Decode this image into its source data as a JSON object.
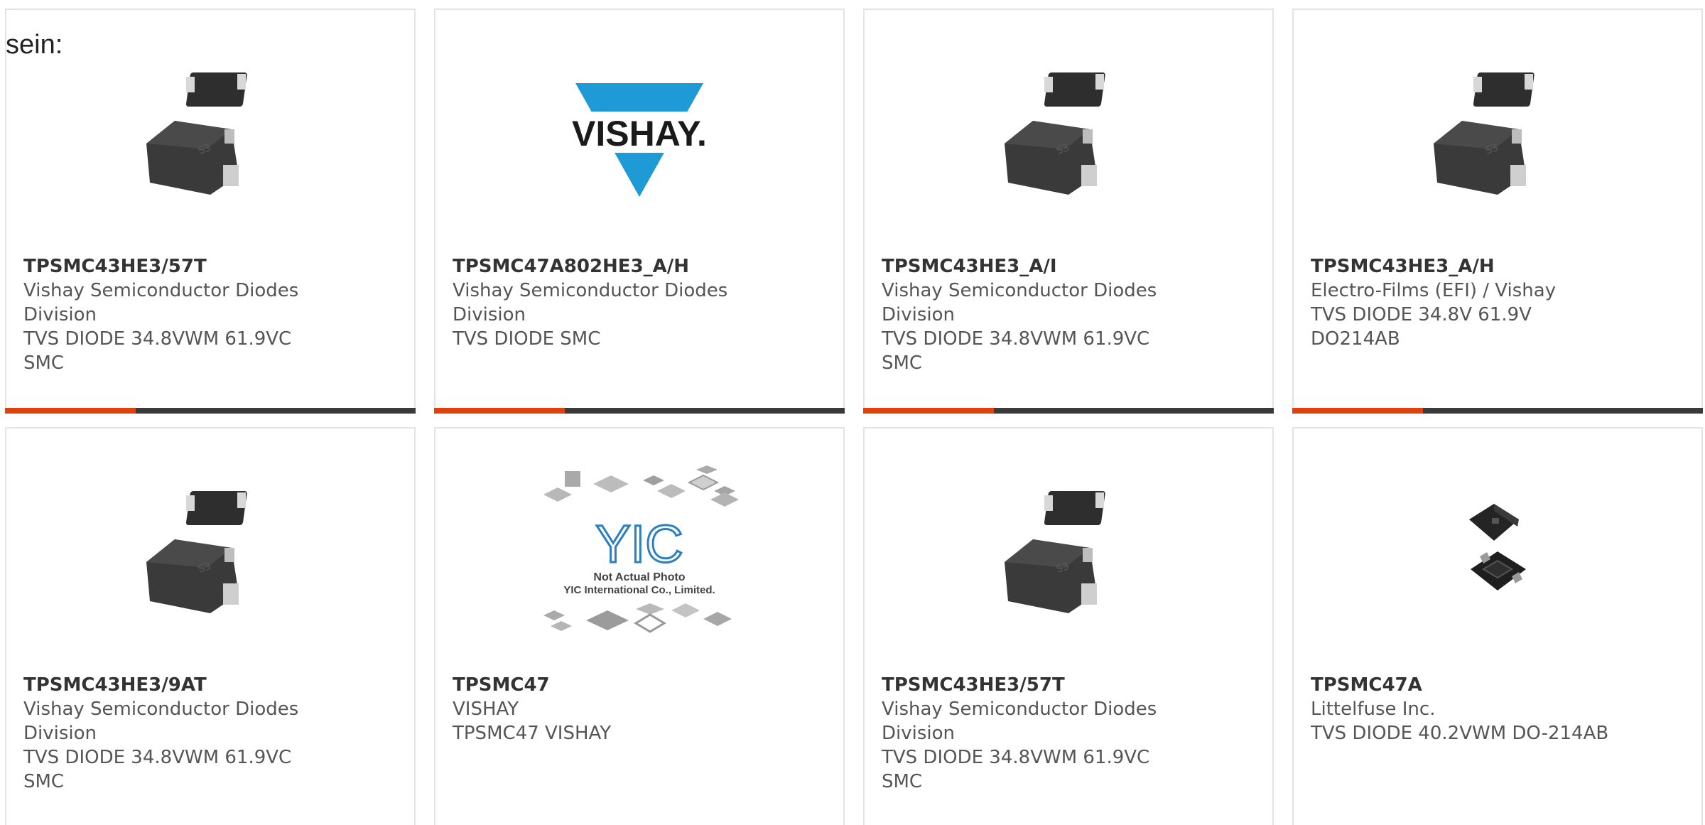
{
  "intro_text": "sein:",
  "colors": {
    "accent": "#e2410c",
    "bar": "#3a3a3a",
    "vishay_blue": "#1e9ad6",
    "yic_blue": "#2b7fc0"
  },
  "cards": [
    {
      "part_number": "TPSMC43HE3/57T",
      "manufacturer": "Vishay Semiconductor Diodes Division",
      "description": "TVS DIODE 34.8VWM 61.9VC SMC",
      "image": "smc-package-photo"
    },
    {
      "part_number": "TPSMC47A802HE3_A/H",
      "manufacturer": "Vishay Semiconductor Diodes Division",
      "description": "TVS DIODE SMC",
      "image": "vishay-logo",
      "logo_text": "VISHAY."
    },
    {
      "part_number": "TPSMC43HE3_A/I",
      "manufacturer": "Vishay Semiconductor Diodes Division",
      "description": "TVS DIODE 34.8VWM 61.9VC SMC",
      "image": "smc-package-photo"
    },
    {
      "part_number": "TPSMC43HE3_A/H",
      "manufacturer": "Electro-Films (EFI) / Vishay",
      "description": "TVS DIODE 34.8V 61.9V DO214AB",
      "image": "smc-package-photo"
    },
    {
      "part_number": "TPSMC43HE3/9AT",
      "manufacturer": "Vishay Semiconductor Diodes Division",
      "description": "TVS DIODE 34.8VWM 61.9VC SMC",
      "image": "smc-package-photo"
    },
    {
      "part_number": "TPSMC47",
      "manufacturer": "VISHAY",
      "description": "TPSMC47 VISHAY",
      "image": "yic-placeholder",
      "placeholder_line1": "Not Actual Photo",
      "placeholder_line2": "YIC International Co., Limited.",
      "placeholder_logo": "YIC"
    },
    {
      "part_number": "TPSMC43HE3/57T",
      "manufacturer": "Vishay Semiconductor Diodes Division",
      "description": "TVS DIODE 34.8VWM 61.9VC SMC",
      "image": "smc-package-photo"
    },
    {
      "part_number": "TPSMC47A",
      "manufacturer": "Littelfuse Inc.",
      "description": "TVS DIODE 40.2VWM DO-214AB",
      "image": "do214-package-photo"
    }
  ]
}
